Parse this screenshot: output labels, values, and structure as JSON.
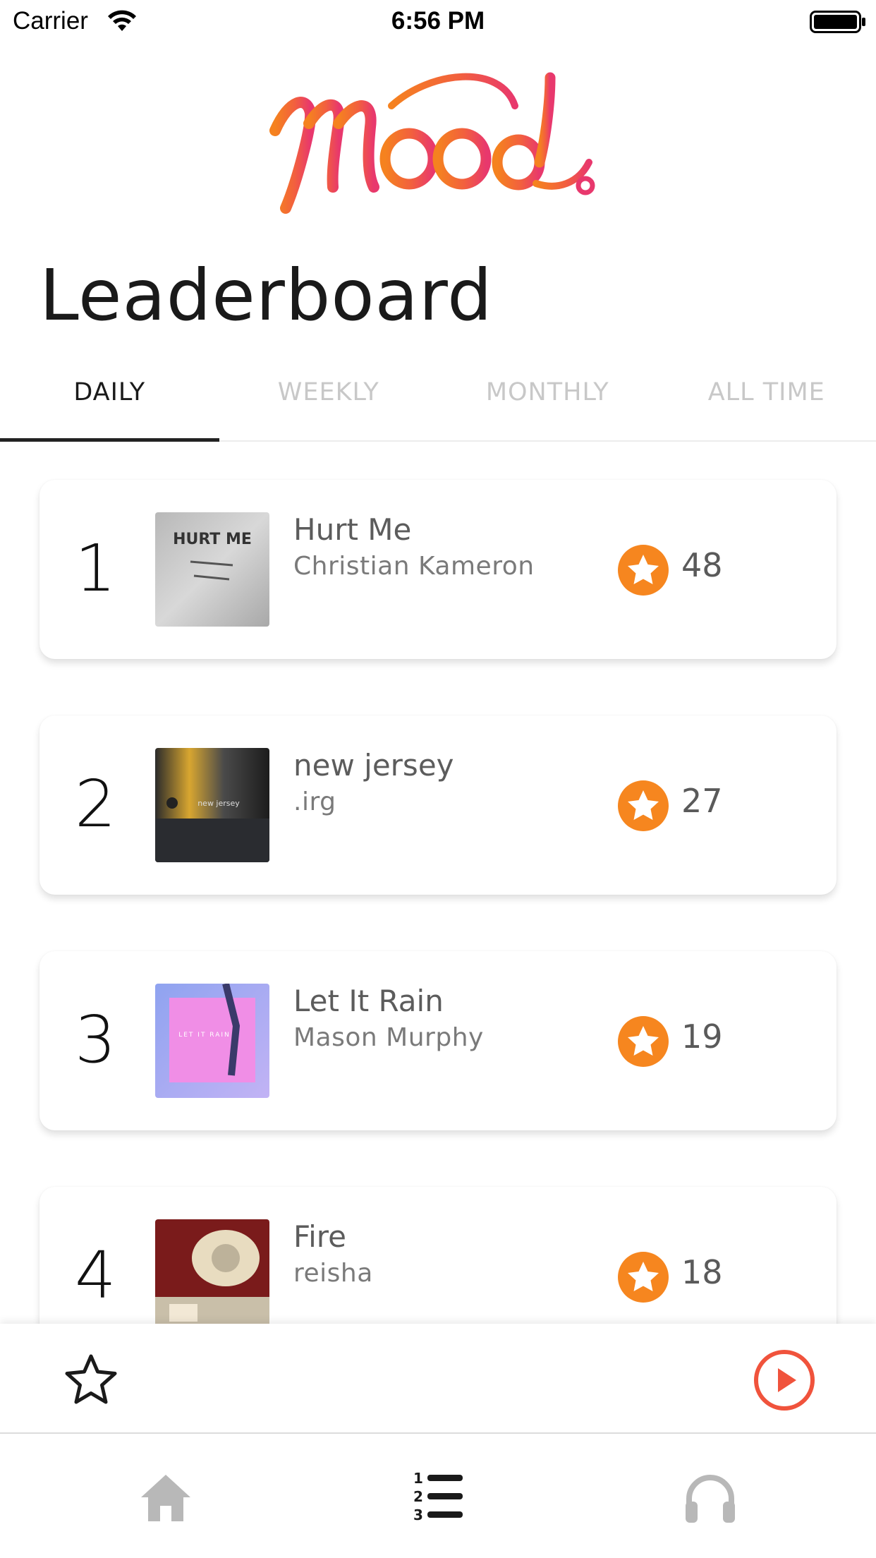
{
  "status_bar": {
    "carrier": "Carrier",
    "time": "6:56 PM"
  },
  "logo": {
    "text": "Mood."
  },
  "header": {
    "title": "Leaderboard"
  },
  "tabs": [
    {
      "label": "DAILY",
      "active": true
    },
    {
      "label": "WEEKLY",
      "active": false
    },
    {
      "label": "MONTHLY",
      "active": false
    },
    {
      "label": "ALL TIME",
      "active": false
    }
  ],
  "leaderboard": [
    {
      "rank": "1",
      "title": "Hurt Me",
      "artist": "Christian Kameron",
      "score": "48",
      "cover_text": "HURT ME"
    },
    {
      "rank": "2",
      "title": "new jersey",
      "artist": ".irg",
      "score": "27",
      "cover_text": "new jersey"
    },
    {
      "rank": "3",
      "title": "Let It Rain",
      "artist": "Mason Murphy",
      "score": "19",
      "cover_text": "LET IT RAIN"
    },
    {
      "rank": "4",
      "title": "Fire",
      "artist": "reisha",
      "score": "18",
      "cover_text": ""
    }
  ],
  "player": {
    "favorite_icon": "star-outline-icon",
    "play_icon": "play-circle-icon"
  },
  "bottom_nav": [
    {
      "icon": "home-icon",
      "active": false
    },
    {
      "icon": "leaderboard-list-icon",
      "active": true
    },
    {
      "icon": "headphones-icon",
      "active": false
    }
  ],
  "colors": {
    "accent": "#f4811f",
    "accent_pink": "#e8386d",
    "score_orange": "#f6861f",
    "play_red": "#f0533c"
  }
}
